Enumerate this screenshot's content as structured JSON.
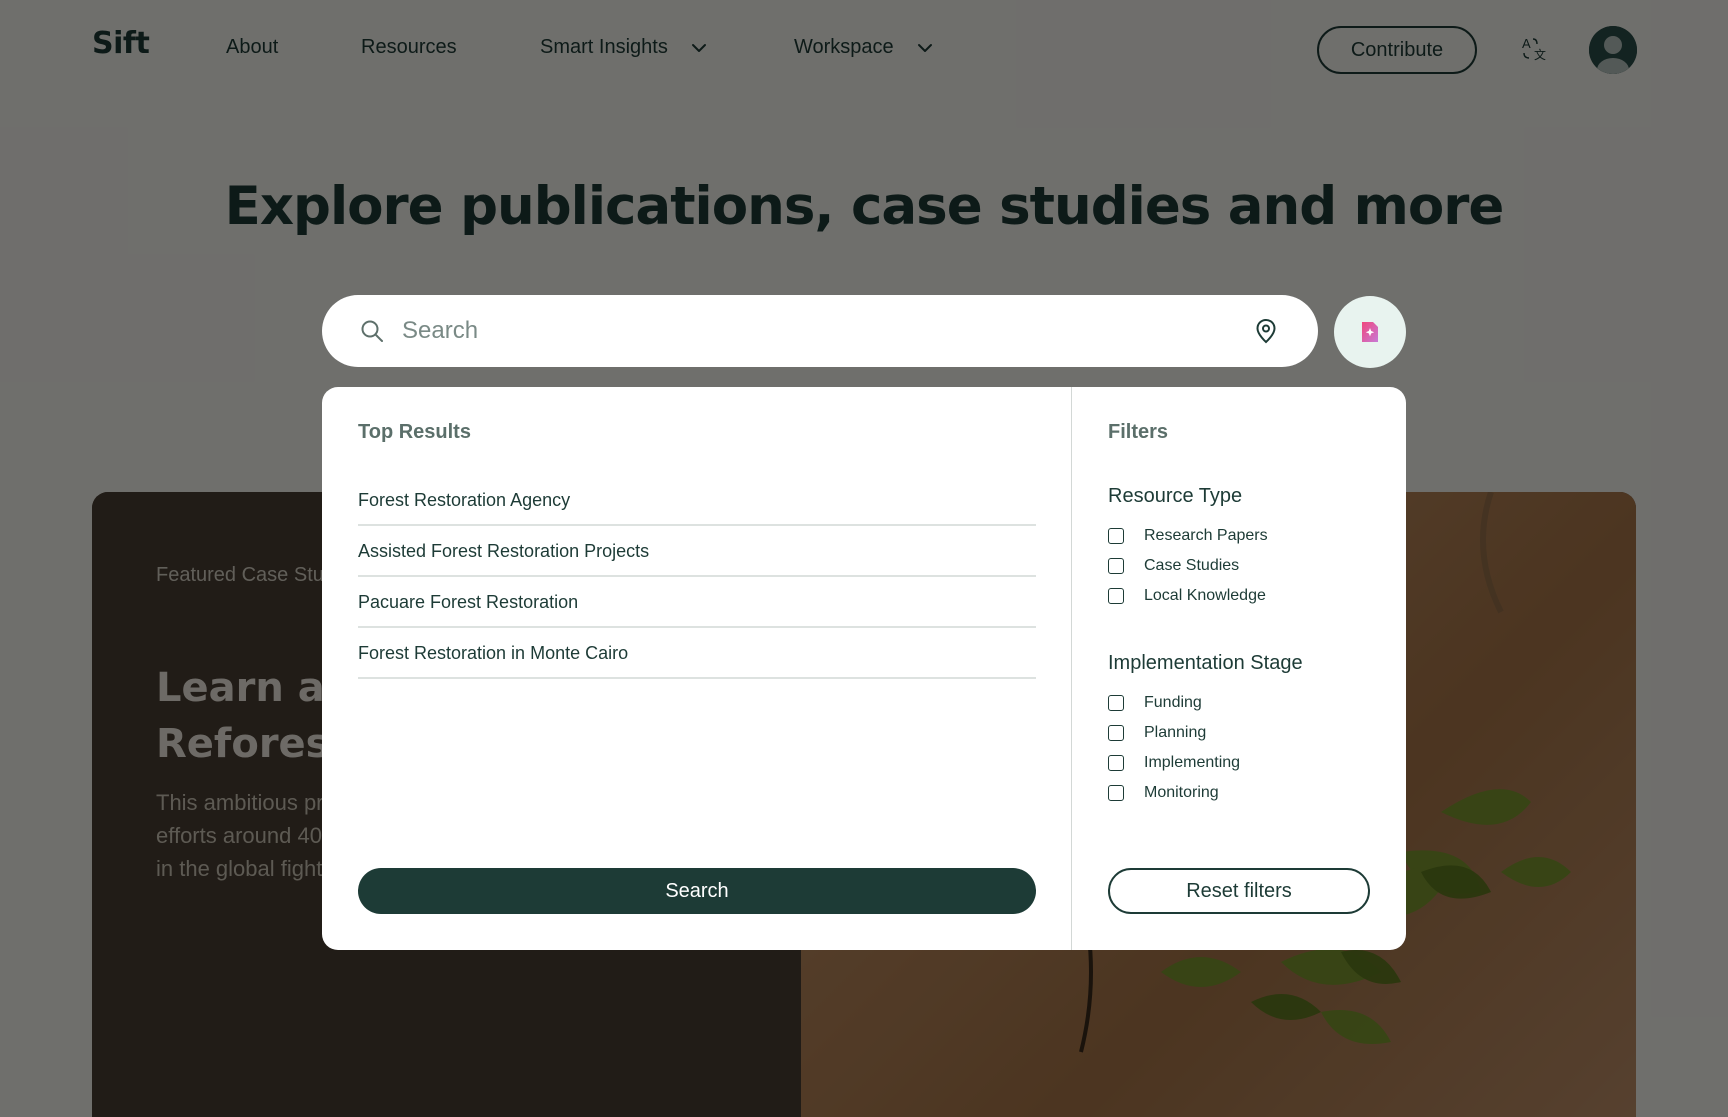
{
  "header": {
    "logo": "Sift",
    "nav": [
      {
        "label": "About",
        "has_dropdown": false
      },
      {
        "label": "Resources",
        "has_dropdown": false
      },
      {
        "label": "Smart Insights",
        "has_dropdown": true
      },
      {
        "label": "Workspace",
        "has_dropdown": true
      }
    ],
    "contribute_label": "Contribute"
  },
  "hero": {
    "title": "Explore publications, case studies and more"
  },
  "search": {
    "placeholder": "Search",
    "value": ""
  },
  "featured": {
    "eyebrow": "Featured Case Stu",
    "title_line1": "Learn ab",
    "title_line2": "Reforest",
    "desc_line1": "This ambitious pr",
    "desc_line2": "efforts around 40",
    "desc_line3": "in the global fight"
  },
  "dropdown": {
    "results_heading": "Top Results",
    "results": [
      "Forest Restoration Agency",
      "Assisted Forest Restoration Projects",
      "Pacuare Forest Restoration",
      "Forest Restoration in Monte Cairo"
    ],
    "search_button_label": "Search",
    "filters_heading": "Filters",
    "resource_type": {
      "title": "Resource Type",
      "options": [
        "Research Papers",
        "Case Studies",
        "Local Knowledge"
      ]
    },
    "implementation_stage": {
      "title": "Implementation Stage",
      "options": [
        "Funding",
        "Planning",
        "Implementing",
        "Monitoring"
      ]
    },
    "reset_label": "Reset filters"
  },
  "colors": {
    "brand_dark": "#1d3b36",
    "ai_button_bg": "#e8f3ef",
    "ai_icon_gradient": [
      "#f0477d",
      "#c77ad6"
    ]
  },
  "icons": {
    "search": "search-icon",
    "location": "map-pin-icon",
    "ai": "ai-sparkle-document-icon",
    "translate": "translate-icon",
    "avatar": "user-avatar-icon",
    "chevron": "chevron-down-icon"
  }
}
